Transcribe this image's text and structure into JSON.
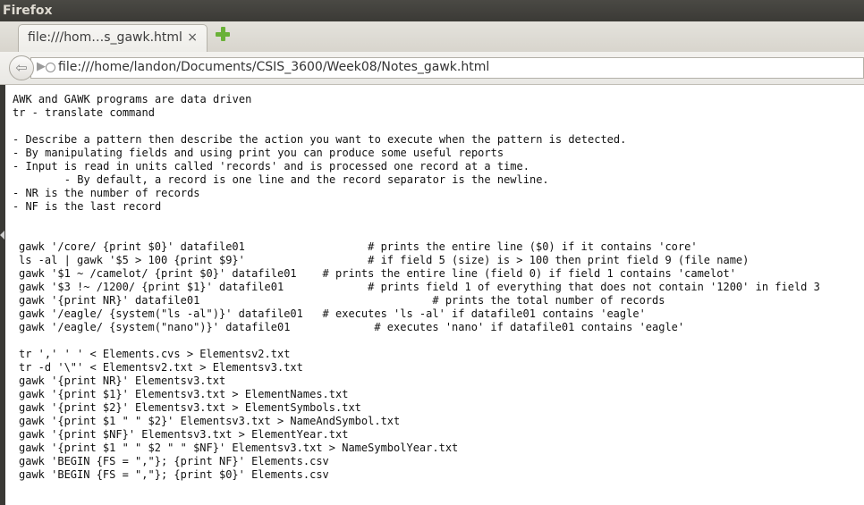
{
  "window": {
    "title": "Firefox"
  },
  "tab": {
    "title": "file:///hom…s_gawk.html",
    "close": "×"
  },
  "navbar": {
    "back": "⇦",
    "forward": "▶",
    "url": "file:///home/landon/Documents/CSIS_3600/Week08/Notes_gawk.html"
  },
  "notes": [
    "AWK and GAWK programs are data driven",
    "tr - translate command",
    "",
    "- Describe a pattern then describe the action you want to execute when the pattern is detected.",
    "- By manipulating fields and using print you can produce some useful reports",
    "- Input is read in units called 'records' and is processed one record at a time.",
    "        - By default, a record is one line and the record separator is the newline.",
    "- NR is the number of records",
    "- NF is the last record"
  ],
  "commands": [
    "gawk '/core/ {print $0}' datafile01                   # prints the entire line ($0) if it contains 'core'",
    "ls -al | gawk '$5 > 100 {print $9}'                   # if field 5 (size) is > 100 then print field 9 (file name)",
    "gawk '$1 ~ /camelot/ {print $0}' datafile01    # prints the entire line (field 0) if field 1 contains 'camelot'",
    "gawk '$3 !~ /1200/ {print $1}' datafile01             # prints field 1 of everything that does not contain '1200' in field 3",
    "gawk '{print NR}' datafile01                                    # prints the total number of records",
    "gawk '/eagle/ {system(\"ls -al\")}' datafile01   # executes 'ls -al' if datafile01 contains 'eagle'",
    "gawk '/eagle/ {system(\"nano\")}' datafile01             # executes 'nano' if datafile01 contains 'eagle'",
    "",
    "tr ',' ' ' < Elements.cvs > Elementsv2.txt",
    "tr -d '\\\"' < Elementsv2.txt > Elementsv3.txt",
    "gawk '{print NR}' Elementsv3.txt",
    "gawk '{print $1}' Elementsv3.txt > ElementNames.txt",
    "gawk '{print $2}' Elementsv3.txt > ElementSymbols.txt",
    "gawk '{print $1 \" \" $2}' Elementsv3.txt > NameAndSymbol.txt",
    "gawk '{print $NF}' Elementsv3.txt > ElementYear.txt",
    "gawk '{print $1 \" \" $2 \" \" $NF}' Elementsv3.txt > NameSymbolYear.txt",
    "gawk 'BEGIN {FS = \",\"}; {print NF}' Elements.csv",
    "gawk 'BEGIN {FS = \",\"}; {print $0}' Elements.csv"
  ],
  "colors": {
    "titlebar": "#3b3a36",
    "accent_newtab": "#6ab138"
  },
  "icons": {
    "back": "back-arrow-icon",
    "forward": "forward-arrow-icon",
    "site": "globe-icon",
    "newtab": "plus-icon",
    "close": "close-icon"
  }
}
